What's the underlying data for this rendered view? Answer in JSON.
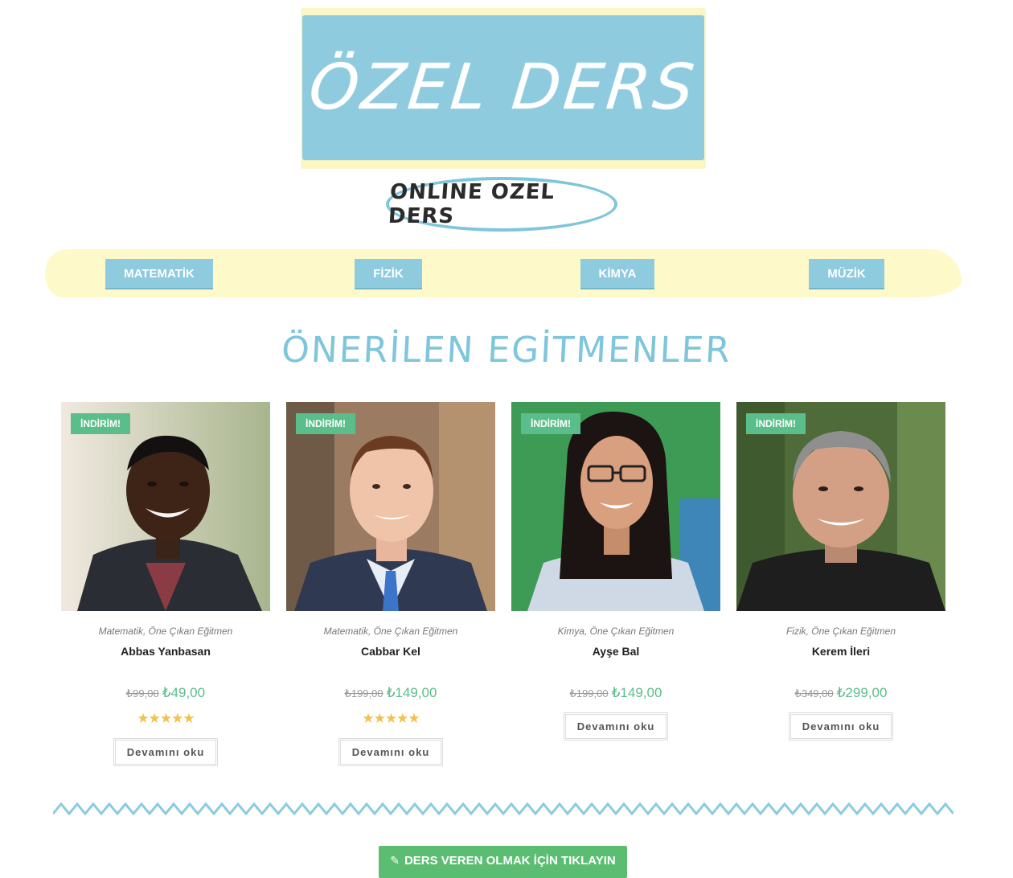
{
  "logo": {
    "title": "ÖZEL DERS",
    "subtitle": "ONLINE OZEL DERS"
  },
  "nav": {
    "items": [
      {
        "label": "MATEMATİK"
      },
      {
        "label": "FİZİK"
      },
      {
        "label": "KİMYA"
      },
      {
        "label": "MÜZİK"
      }
    ]
  },
  "section": {
    "heading": "ÖNERİLEN EGİTMENLER"
  },
  "products": [
    {
      "badge": "İNDİRİM!",
      "categories": "Matematik, Öne Çıkan Eğitmen",
      "name": "Abbas Yanbasan",
      "old_price": "₺99,00",
      "new_price": "₺49,00",
      "rating": 5,
      "stars": "★★★★★",
      "button": "Devamını oku",
      "photo_icon": "portrait-man-leather-jacket"
    },
    {
      "badge": "İNDİRİM!",
      "categories": "Matematik, Öne Çıkan Eğitmen",
      "name": "Cabbar Kel",
      "old_price": "₺199,00",
      "new_price": "₺149,00",
      "rating": 5,
      "stars": "★★★★★",
      "button": "Devamını oku",
      "photo_icon": "portrait-man-suit"
    },
    {
      "badge": "İNDİRİM!",
      "categories": "Kimya, Öne Çıkan Eğitmen",
      "name": "Ayşe Bal",
      "old_price": "₺199,00",
      "new_price": "₺149,00",
      "button": "Devamını oku",
      "photo_icon": "portrait-woman-glasses"
    },
    {
      "badge": "İNDİRİM!",
      "categories": "Fizik, Öne Çıkan Eğitmen",
      "name": "Kerem İleri",
      "old_price": "₺349,00",
      "new_price": "₺299,00",
      "button": "Devamını oku",
      "photo_icon": "portrait-man-grey-hair"
    }
  ],
  "cta": {
    "label": "DERS VEREN OLMAK İÇİN TIKLAYIN",
    "icon": "pencil-icon"
  },
  "colors": {
    "accent_blue": "#8ecbdf",
    "pale_yellow": "#fdf9c9",
    "sale_green": "#5bbd8a",
    "star_gold": "#f2c14e"
  }
}
